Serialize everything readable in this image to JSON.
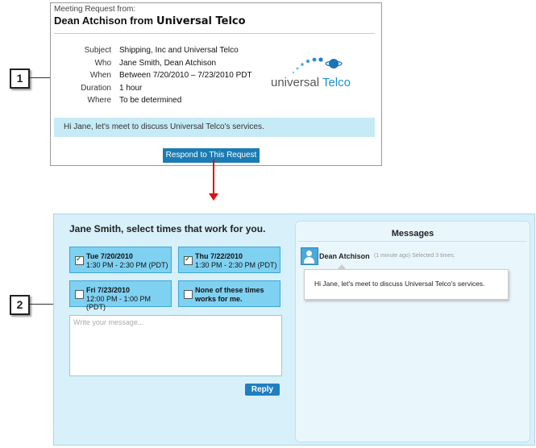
{
  "callouts": [
    "1",
    "2"
  ],
  "email": {
    "from_label": "Meeting Request from:",
    "from_name": "Dean Atchison from",
    "from_company": "Universal Telco",
    "fields": [
      {
        "key": "Subject",
        "value": "Shipping, Inc and Universal Telco"
      },
      {
        "key": "Who",
        "value": "Jane Smith, Dean Atchison"
      },
      {
        "key": "When",
        "value": "Between 7/20/2010 – 7/23/2010 PDT"
      },
      {
        "key": "Duration",
        "value": "1 hour"
      },
      {
        "key": "Where",
        "value": "To be determined"
      }
    ],
    "logo": {
      "word1": "universal",
      "word2": "Telco"
    },
    "message": "Hi Jane, let's meet to discuss Universal Telco's services.",
    "respond_button": "Respond to This Request"
  },
  "scheduler": {
    "title": "Jane Smith, select times that work for you.",
    "slots": [
      {
        "date": "Tue 7/20/2010",
        "time": "1:30 PM - 2:30 PM (PDT)",
        "checked": true
      },
      {
        "date": "Thu 7/22/2010",
        "time": "1:30 PM - 2:30 PM (PDT)",
        "checked": true
      },
      {
        "date": "Fri 7/23/2010",
        "time": "12:00 PM - 1:00 PM (PDT)",
        "checked": false
      },
      {
        "date": "None of these times",
        "time": "works for me.",
        "checked": false
      }
    ],
    "message_placeholder": "Write your message...",
    "reply_button": "Reply"
  },
  "messages": {
    "title": "Messages",
    "author": "Dean Atchison",
    "meta": "(1 minute ago)  Selected 3 times.",
    "text": "Hi Jane, let's meet to discuss Universal Telco's services."
  },
  "colors": {
    "accent": "#1a7cb3",
    "arrow": "#dd1111",
    "panel_bg": "#d7f0fa",
    "slot_bg": "#7fd1f2"
  }
}
